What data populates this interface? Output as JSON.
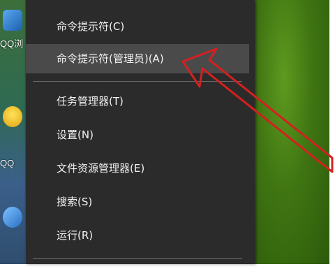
{
  "desktop": {
    "icons": [
      {
        "name": "app-icon-1",
        "label": "",
        "color": "#2b7fd4"
      },
      {
        "name": "qq-icon-top",
        "label": "QQ浏",
        "color": "#1a9bd8"
      },
      {
        "name": "qq-icon-bottom",
        "label": "QQ",
        "color": "#f2c01e"
      },
      {
        "name": "app-icon-4",
        "label": "",
        "color": "#3a86d1"
      }
    ]
  },
  "context_menu": {
    "items": [
      {
        "label": "命令提示符(C)",
        "highlighted": false
      },
      {
        "label": "命令提示符(管理员)(A)",
        "highlighted": true
      },
      {
        "label": "任务管理器(T)",
        "highlighted": false
      },
      {
        "label": "设置(N)",
        "highlighted": false
      },
      {
        "label": "文件资源管理器(E)",
        "highlighted": false
      },
      {
        "label": "搜索(S)",
        "highlighted": false
      },
      {
        "label": "运行(R)",
        "highlighted": false
      }
    ],
    "colors": {
      "background": "#2b2b2b",
      "highlight": "#4a4a4a",
      "text": "#f2f2f2"
    }
  },
  "annotation": {
    "arrow_color": "#d42020",
    "points_to": "命令提示符(管理员)(A)"
  }
}
